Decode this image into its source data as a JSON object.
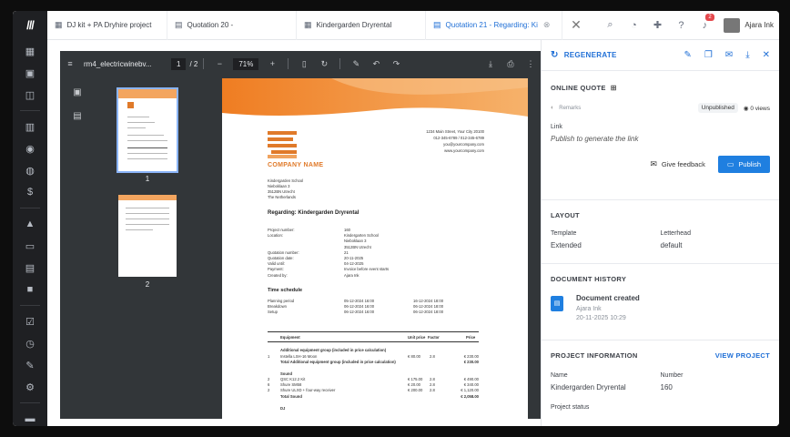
{
  "tabs": [
    {
      "label": "DJ kit + PA Dryhire project",
      "icon": "project-icon"
    },
    {
      "label": "Quotation 20 -",
      "icon": "document-icon"
    },
    {
      "label": "Kindergarden Dryrental",
      "icon": "calendar-grid-icon"
    },
    {
      "label": "Quotation 21 - Regarding: Ki",
      "icon": "document-icon",
      "active": true
    }
  ],
  "topbar": {
    "notifications_count": "2",
    "user_name": "Ajara Ink"
  },
  "viewer": {
    "file_name": "rm4_electricwinebv...",
    "page_current": "1",
    "page_total": "/ 2",
    "zoom": "71%",
    "thumb_labels": [
      "1",
      "2"
    ]
  },
  "document": {
    "company_name": "COMPANY NAME",
    "sender": [
      "1234 Main Street, Your City 20100",
      "012-345-6789 / 012-345-6789",
      "you@yourcompany.com",
      "www.yourcompany.com"
    ],
    "recipient": [
      "Kindergarden School",
      "Nieboklaan 3",
      "3512BN Utrecht",
      "The Netherlands"
    ],
    "heading": "Regarding: Kindergarden Dryrental",
    "details": [
      [
        "Project number:",
        "160"
      ],
      [
        "Location:",
        "Kindergarten School"
      ],
      [
        "",
        "Nieboklaan 3"
      ],
      [
        "",
        "3512BN Utrecht"
      ],
      [
        "Quotation number:",
        "21"
      ],
      [
        "Quotation date:",
        "20-11-2025"
      ],
      [
        "Valid until:",
        "04-12-2025"
      ],
      [
        "Payment:",
        "Invoice before event starts"
      ],
      [
        "Created by:",
        "Ajara Ink"
      ]
    ],
    "time_schedule_title": "Time schedule",
    "schedule": [
      [
        "Planning period",
        "05-12-2024 16:00",
        "16-12-2024 18:00"
      ],
      [
        "Breakdown",
        "06-12-2024 16:00",
        "06-12-2024 18:00"
      ],
      [
        "Setup",
        "06-12-2024 16:00",
        "06-12-2024 18:00"
      ]
    ],
    "table_headers": [
      "Equipment",
      "Unit price",
      "Factor",
      "Price"
    ],
    "group1_title": "Additional equipment group (included in price calculation)",
    "group1_rows": [
      [
        "1",
        "Instella LSH-16 Moon",
        "€ 80.00",
        "2.8",
        "€ 230.00"
      ]
    ],
    "group1_total": [
      "Total Additional equipment group (included in price calculation)",
      "€ 230.00"
    ],
    "group2_title": "Sound",
    "group2_rows": [
      [
        "2",
        "QSC K12.2 Kit",
        "€ 175.00",
        "2.8",
        "€ 490.00"
      ],
      [
        "6",
        "Shure SM58",
        "€ 20.00",
        "2.8",
        "€ 340.00"
      ],
      [
        "2",
        "Shure ULXD + four-way receiver",
        "€ 200.00",
        "2.8",
        "€ 1,120.00"
      ]
    ],
    "group2_total": [
      "Total Sound",
      "€ 2,058.00"
    ],
    "group3_title": "DJ"
  },
  "panel": {
    "regenerate_label": "REGENERATE",
    "online_quote_title": "ONLINE QUOTE",
    "remarks_label": "Remarks",
    "status_badge": "Unpublished",
    "views_label": "0 views",
    "link_label": "Link",
    "link_value": "Publish to generate the link",
    "feedback_label": "Give feedback",
    "publish_label": "Publish",
    "layout_title": "LAYOUT",
    "template_label": "Template",
    "template_value": "Extended",
    "letterhead_label": "Letterhead",
    "letterhead_value": "default",
    "history_title": "DOCUMENT HISTORY",
    "history_event": "Document created",
    "history_user": "Ajara Ink",
    "history_date": "20-11-2025 10:29",
    "project_info_title": "PROJECT INFORMATION",
    "view_project_label": "VIEW PROJECT",
    "name_label": "Name",
    "name_value": "Kindergarden Dryrental",
    "number_label": "Number",
    "number_value": "160",
    "status_label": "Project status"
  },
  "colors": {
    "accent": "#1f6fd6",
    "brand_orange": "#e07a2a",
    "rail": "#1f2023",
    "viewer_bg": "#323639"
  }
}
